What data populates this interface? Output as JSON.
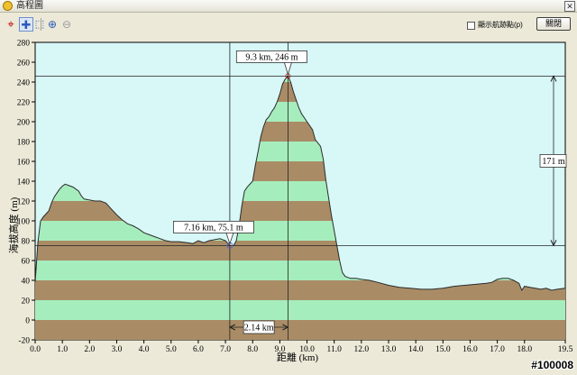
{
  "window": {
    "title": "高程圖",
    "close_button": "關閉",
    "checkbox_label": "顯示航跡點(p)"
  },
  "toolbar": {
    "icons": [
      "crosshair-red-icon",
      "crosshair-blue-icon",
      "zoom-rect-icon",
      "zoom-in-icon",
      "zoom-out-icon"
    ]
  },
  "chart_data": {
    "type": "area",
    "xlabel": "距離 (km)",
    "ylabel": "海拔高度 (m)",
    "xlim": [
      0,
      19.5
    ],
    "ylim": [
      -20,
      280
    ],
    "x_ticks": [
      "0.0",
      "1.0",
      "2.0",
      "3.0",
      "4.0",
      "5.0",
      "6.0",
      "7.0",
      "8.0",
      "9.0",
      "10.0",
      "11.0",
      "12.0",
      "13.0",
      "14.0",
      "15.0",
      "16.0",
      "17.0",
      "18.0",
      "19.5"
    ],
    "y_ticks": [
      "280",
      "260",
      "240",
      "220",
      "200",
      "180",
      "160",
      "140",
      "120",
      "100",
      "80",
      "60",
      "40",
      "20",
      "0",
      "-20"
    ],
    "stripe_colors": [
      "#a98c66",
      "#a6edbd"
    ],
    "background": "#d8f7f7",
    "profile": [
      [
        0.0,
        38
      ],
      [
        0.1,
        78
      ],
      [
        0.2,
        100
      ],
      [
        0.3,
        104
      ],
      [
        0.5,
        110
      ],
      [
        0.6,
        118
      ],
      [
        0.7,
        124
      ],
      [
        0.8,
        128
      ],
      [
        0.9,
        132
      ],
      [
        1.0,
        135
      ],
      [
        1.1,
        137
      ],
      [
        1.2,
        136
      ],
      [
        1.4,
        134
      ],
      [
        1.6,
        130
      ],
      [
        1.7,
        125
      ],
      [
        1.8,
        122
      ],
      [
        2.0,
        121
      ],
      [
        2.2,
        120
      ],
      [
        2.4,
        120
      ],
      [
        2.6,
        118
      ],
      [
        2.8,
        112
      ],
      [
        3.0,
        106
      ],
      [
        3.2,
        101
      ],
      [
        3.4,
        97
      ],
      [
        3.6,
        95
      ],
      [
        3.8,
        92
      ],
      [
        4.0,
        88
      ],
      [
        4.2,
        86
      ],
      [
        4.4,
        84
      ],
      [
        4.6,
        82
      ],
      [
        4.8,
        80
      ],
      [
        5.0,
        79
      ],
      [
        5.3,
        79
      ],
      [
        5.6,
        78
      ],
      [
        5.8,
        77
      ],
      [
        6.0,
        80
      ],
      [
        6.2,
        78
      ],
      [
        6.4,
        80
      ],
      [
        6.6,
        81
      ],
      [
        6.8,
        82
      ],
      [
        7.0,
        80
      ],
      [
        7.16,
        75.1
      ],
      [
        7.3,
        75
      ],
      [
        7.4,
        80
      ],
      [
        7.5,
        95
      ],
      [
        7.6,
        115
      ],
      [
        7.7,
        130
      ],
      [
        7.8,
        134
      ],
      [
        8.0,
        140
      ],
      [
        8.1,
        156
      ],
      [
        8.2,
        170
      ],
      [
        8.3,
        185
      ],
      [
        8.4,
        195
      ],
      [
        8.5,
        202
      ],
      [
        8.6,
        205
      ],
      [
        8.7,
        210
      ],
      [
        8.8,
        214
      ],
      [
        8.9,
        220
      ],
      [
        9.0,
        228
      ],
      [
        9.1,
        238
      ],
      [
        9.2,
        243
      ],
      [
        9.3,
        246
      ],
      [
        9.4,
        240
      ],
      [
        9.5,
        230
      ],
      [
        9.6,
        222
      ],
      [
        9.7,
        214
      ],
      [
        9.8,
        208
      ],
      [
        10.0,
        200
      ],
      [
        10.2,
        192
      ],
      [
        10.3,
        182
      ],
      [
        10.5,
        175
      ],
      [
        10.6,
        162
      ],
      [
        10.7,
        140
      ],
      [
        10.8,
        122
      ],
      [
        10.9,
        105
      ],
      [
        11.0,
        90
      ],
      [
        11.1,
        75
      ],
      [
        11.2,
        60
      ],
      [
        11.3,
        48
      ],
      [
        11.4,
        44
      ],
      [
        11.6,
        42
      ],
      [
        11.8,
        42
      ],
      [
        12.0,
        41
      ],
      [
        12.3,
        40
      ],
      [
        12.6,
        38
      ],
      [
        13.0,
        35
      ],
      [
        13.4,
        33
      ],
      [
        13.8,
        32
      ],
      [
        14.2,
        31
      ],
      [
        14.6,
        31
      ],
      [
        15.0,
        32
      ],
      [
        15.4,
        34
      ],
      [
        15.8,
        35
      ],
      [
        16.2,
        36
      ],
      [
        16.6,
        37
      ],
      [
        16.8,
        38
      ],
      [
        17.0,
        41
      ],
      [
        17.2,
        42
      ],
      [
        17.4,
        42
      ],
      [
        17.6,
        40
      ],
      [
        17.8,
        37
      ],
      [
        17.9,
        30
      ],
      [
        18.0,
        34
      ],
      [
        18.2,
        33
      ],
      [
        18.4,
        32
      ],
      [
        18.6,
        31
      ],
      [
        18.8,
        32
      ],
      [
        19.0,
        30
      ],
      [
        19.2,
        31
      ],
      [
        19.5,
        32
      ]
    ],
    "annotations": {
      "point1_label": "7.16 km, 75.1 m",
      "point2_label": "9.3 km, 246 m",
      "height_diff_label": "171 m",
      "distance_diff_label": "2.14 km"
    },
    "points": {
      "p1": [
        7.16,
        75.1
      ],
      "p2": [
        9.3,
        246
      ]
    }
  },
  "watermark": "#100008"
}
